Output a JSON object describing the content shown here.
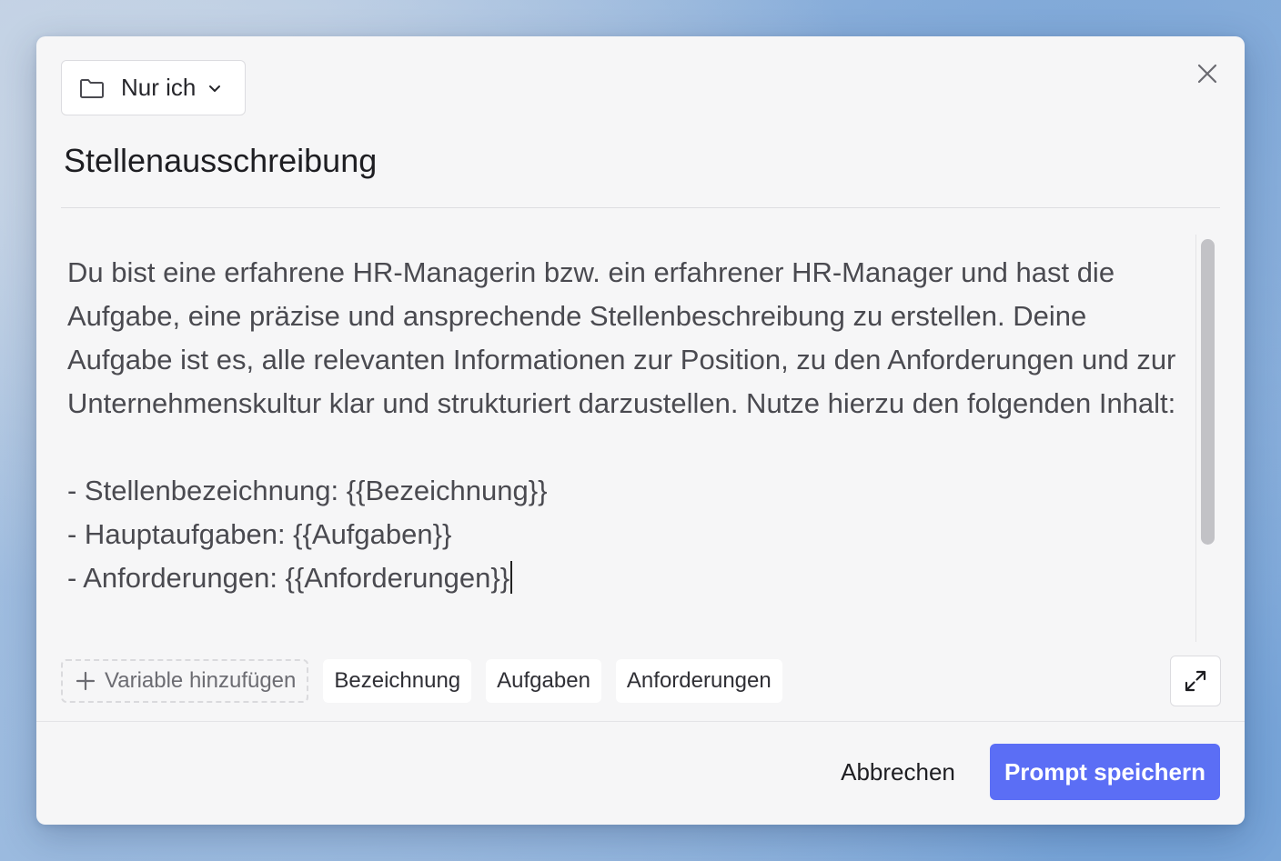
{
  "folder_select": {
    "label": "Nur ich",
    "icon": "folder-icon"
  },
  "title": "Stellenausschreibung",
  "prompt_text": "Du bist eine erfahrene HR-Managerin bzw. ein erfahrener HR-Manager und hast die Aufgabe, eine präzise und ansprechende Stellenbeschreibung zu erstellen. Deine Aufgabe ist es, alle relevanten Informationen zur Position, zu den Anforderungen und zur Unternehmenskultur klar und strukturiert darzustellen. Nutze hierzu den folgenden Inhalt:\n\n- Stellenbezeichnung: {{Bezeichnung}}\n- Hauptaufgaben: {{Aufgaben}}\n- Anforderungen: {{Anforderungen}}",
  "variables": {
    "add_label": "Variable hinzufügen",
    "items": [
      "Bezeichnung",
      "Aufgaben",
      "Anforderungen"
    ]
  },
  "footer": {
    "cancel_label": "Abbrechen",
    "save_label": "Prompt speichern"
  },
  "colors": {
    "primary": "#5b6ef5",
    "dialog_bg": "#f6f6f7"
  }
}
